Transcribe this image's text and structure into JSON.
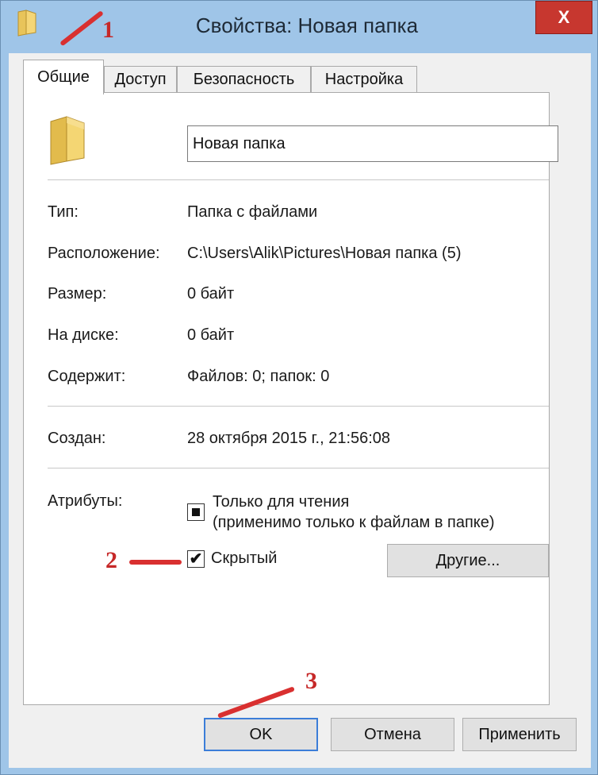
{
  "window": {
    "title": "Свойства: Новая папка",
    "close_glyph": "X",
    "folder_icon": "folder-icon"
  },
  "tabs": [
    {
      "label": "Общие",
      "active": true
    },
    {
      "label": "Доступ",
      "active": false
    },
    {
      "label": "Безопасность",
      "active": false
    },
    {
      "label": "Настройка",
      "active": false
    }
  ],
  "general": {
    "folder_name": "Новая папка",
    "rows": [
      {
        "label": "Тип:",
        "value": "Папка с файлами"
      },
      {
        "label": "Расположение:",
        "value": "C:\\Users\\Alik\\Pictures\\Новая папка (5)"
      },
      {
        "label": "Размер:",
        "value": "0 байт"
      },
      {
        "label": "На диске:",
        "value": "0 байт"
      },
      {
        "label": "Содержит:",
        "value": "Файлов: 0; папок: 0"
      }
    ],
    "created": {
      "label": "Создан:",
      "value": "28 октября 2015 г., 21:56:08"
    },
    "attributes": {
      "label": "Атрибуты:",
      "readonly_line1": "Только для чтения",
      "readonly_line2": "(применимо только к файлам в папке)",
      "readonly_state": "indeterminate",
      "hidden_label": "Скрытый",
      "hidden_checked": true,
      "other_button": "Другие..."
    }
  },
  "buttons": {
    "ok": "OK",
    "cancel": "Отмена",
    "apply": "Применить"
  },
  "annotations": [
    {
      "number": "1"
    },
    {
      "number": "2"
    },
    {
      "number": "3"
    }
  ],
  "colors": {
    "frame": "#9fc5e8",
    "close": "#c7372f",
    "annotation": "#d93030"
  }
}
